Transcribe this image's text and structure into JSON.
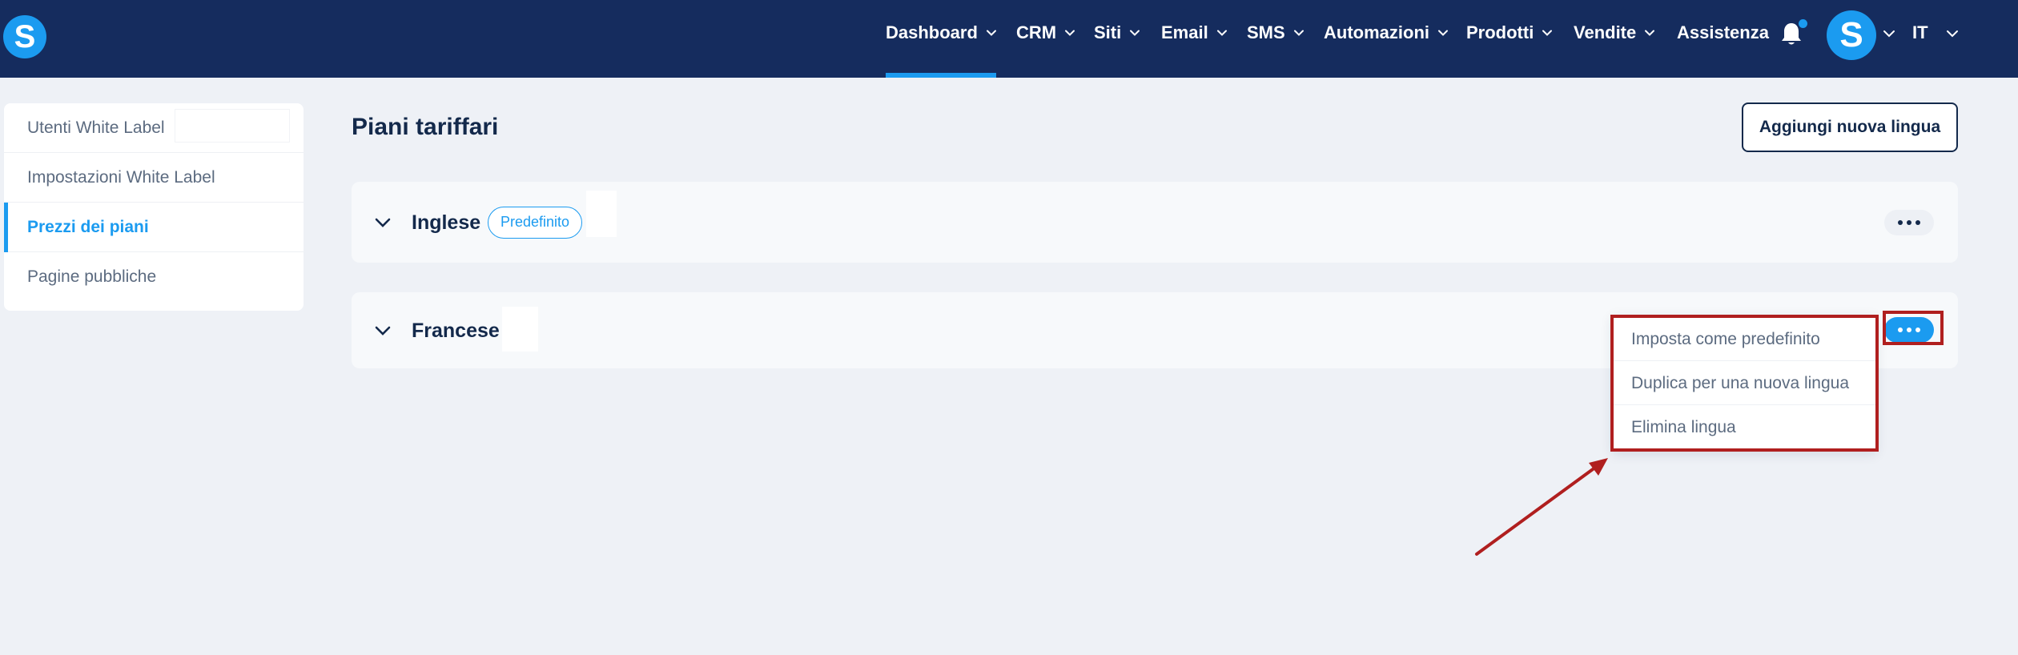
{
  "brand": {
    "logo_letter": "S"
  },
  "nav": {
    "items": [
      {
        "label": "Dashboard",
        "has_chevron": true,
        "active": true
      },
      {
        "label": "CRM",
        "has_chevron": true
      },
      {
        "label": "Siti",
        "has_chevron": true
      },
      {
        "label": "Email",
        "has_chevron": true
      },
      {
        "label": "SMS",
        "has_chevron": true
      },
      {
        "label": "Automazioni",
        "has_chevron": true
      },
      {
        "label": "Prodotti",
        "has_chevron": true
      },
      {
        "label": "Vendite",
        "has_chevron": true
      },
      {
        "label": "Assistenza",
        "has_chevron": false
      }
    ],
    "notification_icon": "bell-icon",
    "avatar_letter": "S",
    "language": "IT"
  },
  "sidebar": {
    "items": [
      {
        "label": "Utenti White Label",
        "active": false
      },
      {
        "label": "Impostazioni White Label",
        "active": false
      },
      {
        "label": "Prezzi dei piani",
        "active": true
      },
      {
        "label": "Pagine pubbliche",
        "active": false
      }
    ]
  },
  "main": {
    "title": "Piani tariffari",
    "add_language_label": "Aggiungi nuova lingua",
    "languages": [
      {
        "name": "Inglese",
        "badge": "Predefinito"
      },
      {
        "name": "Francese",
        "badge": ""
      }
    ],
    "menu": {
      "items": [
        "Imposta come predefinito",
        "Duplica per una nuova lingua",
        "Elimina lingua"
      ]
    }
  },
  "colors": {
    "topbar": "#152c5e",
    "accent": "#1b9bf0",
    "background": "#eef1f6",
    "annotation": "#b01f1f"
  }
}
